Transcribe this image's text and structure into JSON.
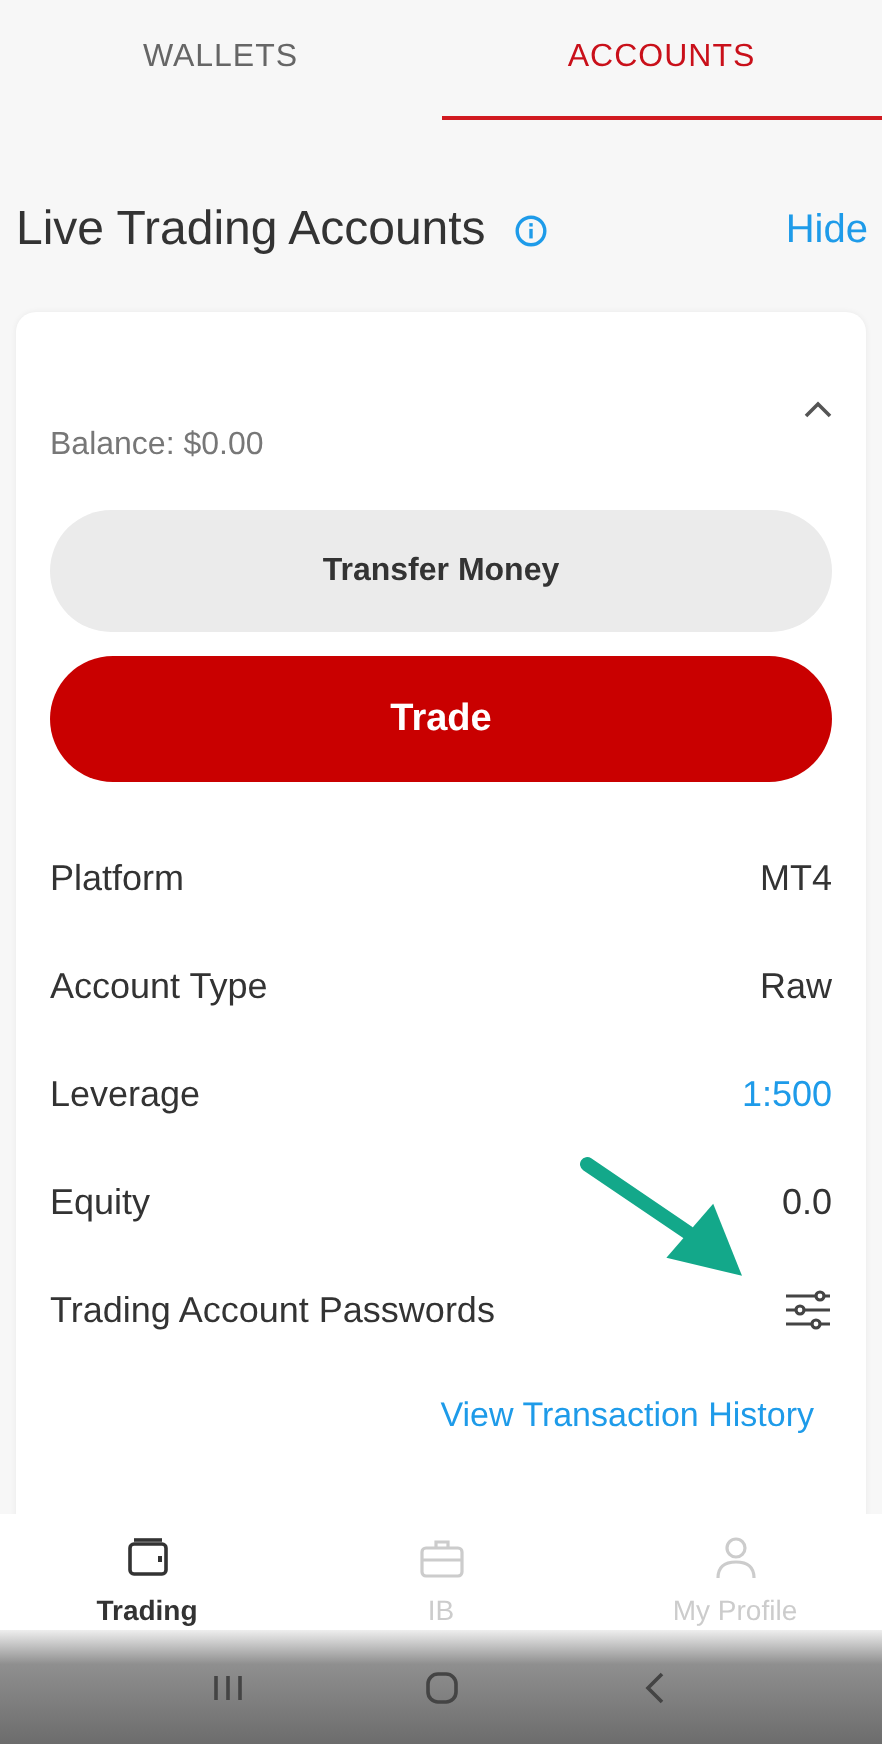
{
  "tabs": [
    {
      "label": "WALLETS",
      "selected": false
    },
    {
      "label": "ACCOUNTS",
      "selected": true
    }
  ],
  "section": {
    "title": "Live Trading Accounts",
    "action": "Hide"
  },
  "account": {
    "expanded": true,
    "balance": "Balance: $0.00",
    "buttons": [
      {
        "label": "Transfer Money",
        "kind": "secondary"
      },
      {
        "label": "Trade",
        "kind": "primary"
      }
    ],
    "rows": [
      {
        "label": "Platform",
        "value": "MT4",
        "kind": "text"
      },
      {
        "label": "Account Type",
        "value": "Raw",
        "kind": "text"
      },
      {
        "label": "Leverage",
        "value": "1:500",
        "kind": "link"
      },
      {
        "label": "Equity",
        "value": "0.0",
        "kind": "text"
      },
      {
        "label": "Trading Account Passwords",
        "kind": "settings"
      }
    ],
    "link": "View Transaction History"
  },
  "bottom_nav": [
    {
      "label": "Trading",
      "selected": true
    },
    {
      "label": "IB",
      "selected": false
    },
    {
      "label": "My Profile",
      "selected": false
    }
  ]
}
